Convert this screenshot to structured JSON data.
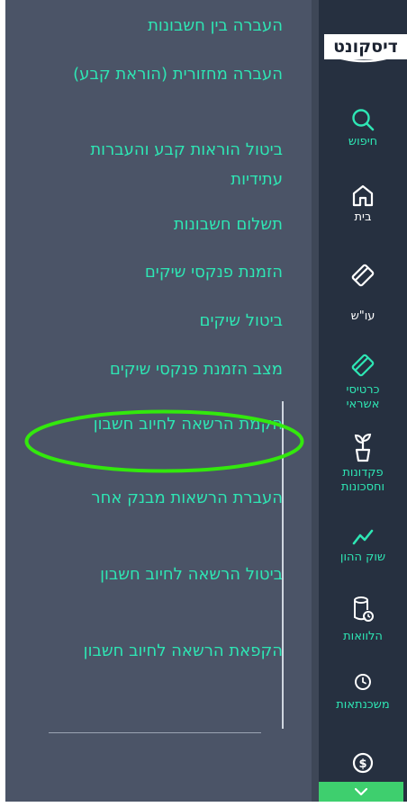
{
  "brand": {
    "logo_text": "דיסקונט"
  },
  "menu": {
    "items": [
      {
        "label": "העברה בין חשבונות"
      },
      {
        "label": "העברה מחזורית (הוראת קבע)"
      },
      {
        "label": "ביטול הוראות קבע והעברות עתידיות"
      },
      {
        "label": "תשלום חשבונות"
      },
      {
        "label": "הזמנת פנקסי שיקים"
      },
      {
        "label": "ביטול שיקים"
      },
      {
        "label": "מצב הזמנת פנקסי שיקים"
      },
      {
        "label": "הקמת הרשאה לחיוב חשבון"
      },
      {
        "label": "העברת הרשאות מבנק אחר"
      },
      {
        "label": "ביטול הרשאה לחיוב חשבון"
      },
      {
        "label": "הקפאת הרשאה לחיוב חשבון"
      }
    ],
    "highlighted_item": "הקמת הרשאה לחיוב חשבון"
  },
  "nav": {
    "items": [
      {
        "label": "חיפוש",
        "icon": "search-icon"
      },
      {
        "label": "בית",
        "icon": "home-icon"
      },
      {
        "label": "עו\"ש",
        "icon": "checking-account-icon"
      },
      {
        "label": "כרטיסי אשראי",
        "icon": "credit-card-icon"
      },
      {
        "label": "פקדונות וחסכונות",
        "icon": "plant-icon"
      },
      {
        "label": "שוק ההון",
        "icon": "trend-line-icon"
      },
      {
        "label": "הלוואות",
        "icon": "loan-icon"
      },
      {
        "label": "משכנתאות",
        "icon": "clock-icon"
      },
      {
        "label": "",
        "icon": "dollar-icon"
      }
    ],
    "expand_icon": "chevron-down-icon"
  },
  "colors": {
    "accent_text": "#2ee6b4",
    "highlight_ring": "#33e80d",
    "rail_background": "#263040",
    "panel_background": "#4b5467",
    "expand_button": "#3ecf6e"
  }
}
